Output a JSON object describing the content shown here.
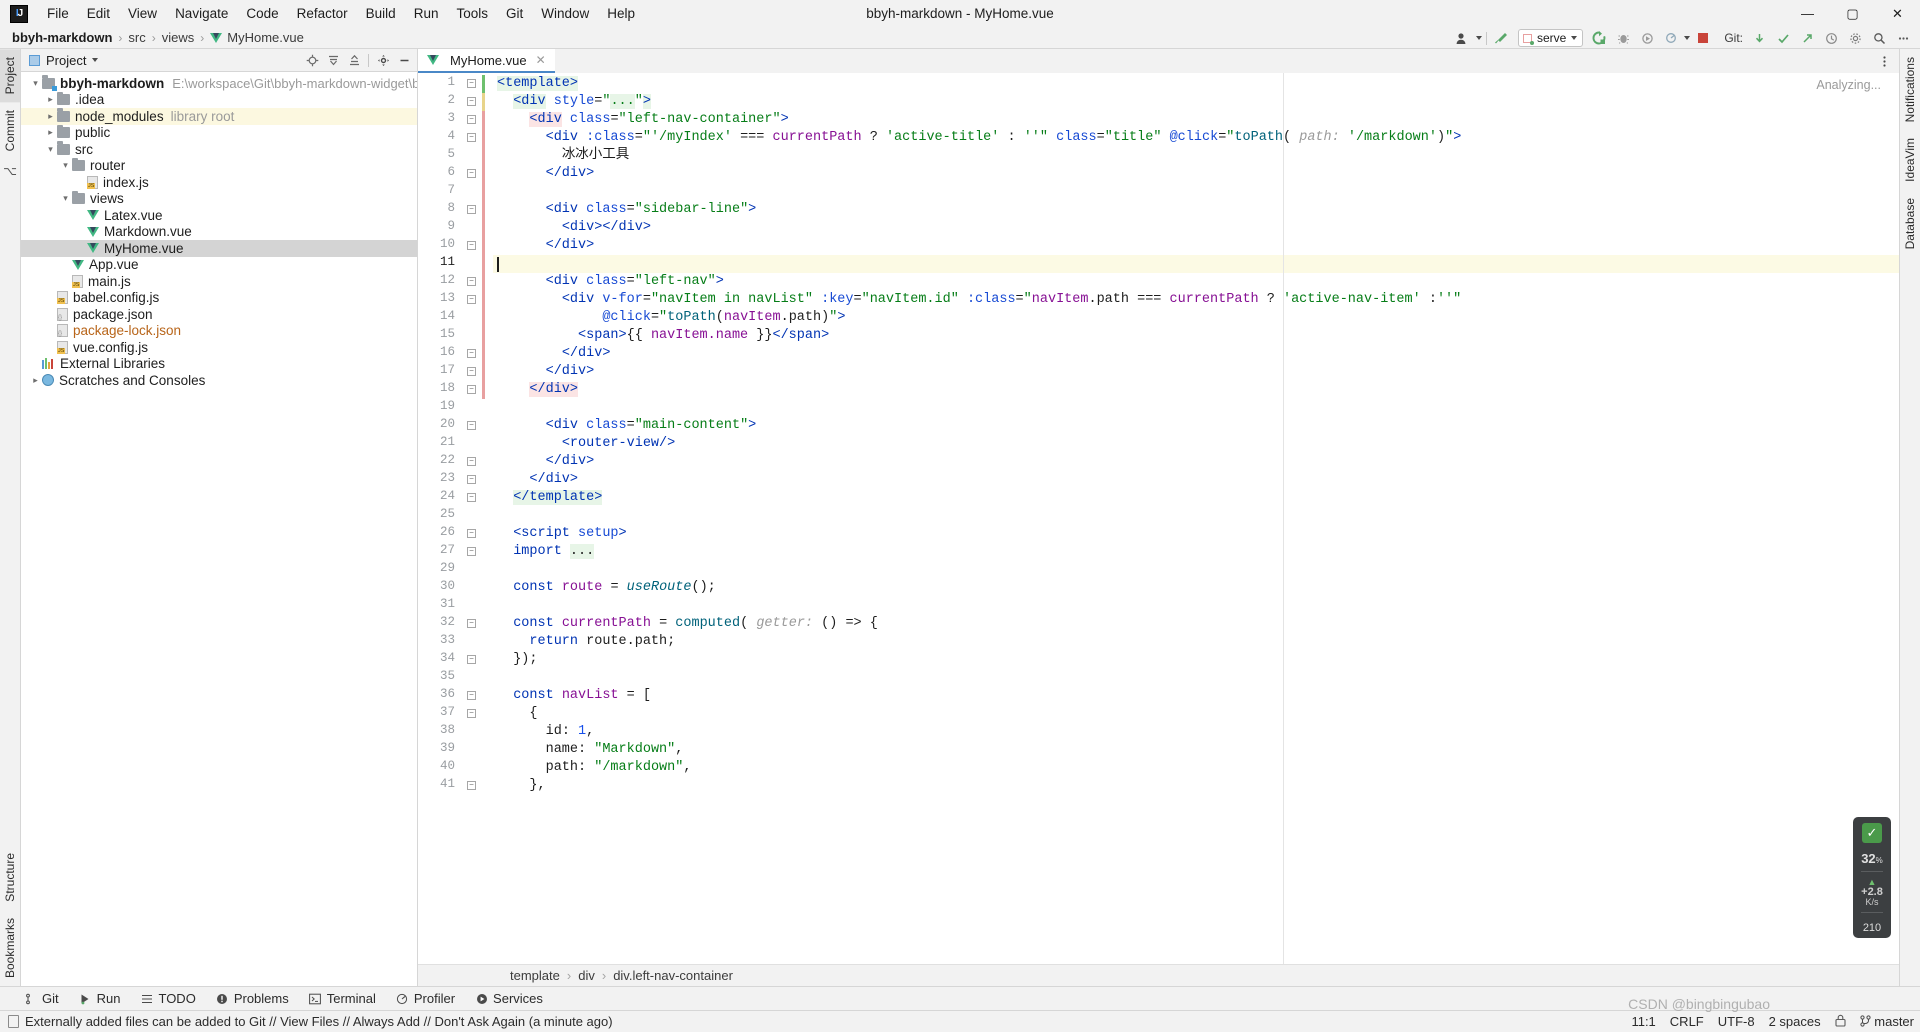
{
  "window": {
    "title": "bbyh-markdown - MyHome.vue",
    "logo_text": "IJ",
    "minimize": "—",
    "maximize": "▢",
    "close": "✕"
  },
  "menu": {
    "items": [
      "File",
      "Edit",
      "View",
      "Navigate",
      "Code",
      "Refactor",
      "Build",
      "Run",
      "Tools",
      "Git",
      "Window",
      "Help"
    ]
  },
  "breadcrumb": {
    "project": "bbyh-markdown",
    "parts": [
      "src",
      "views"
    ],
    "file": "MyHome.vue",
    "separator": "›"
  },
  "toolbar": {
    "profile_icon": "user-icon",
    "hammer_icon": "build-hammer-icon",
    "run_config": "serve",
    "rerun_icon": "rerun-icon",
    "debug_icon": "debug-icon",
    "stop_icon": "stop-icon",
    "git_label": "Git:",
    "git_update_icon": "git-update-icon",
    "git_commit_icon": "git-commit-icon",
    "git_push_icon": "git-push-icon",
    "history_icon": "history-icon",
    "settings_icon": "settings-gear-icon",
    "search_icon": "search-icon",
    "more_icon": "more-icon"
  },
  "left_rail": {
    "top": [
      "Project"
    ],
    "bottom": [
      "Structure",
      "Bookmarks"
    ],
    "commit": "Commit"
  },
  "right_rail": {
    "items": [
      "Notifications",
      "Database",
      "IdeaVim"
    ]
  },
  "project_pane": {
    "title": "Project",
    "icons": [
      "locate-icon",
      "expand-all-icon",
      "collapse-all-icon",
      "settings-icon",
      "hide-icon"
    ],
    "tree": [
      {
        "indent": 0,
        "arrow": "v",
        "icon": "folder-module",
        "label": "bbyh-markdown",
        "bold": true,
        "path": "E:\\workspace\\Git\\bbyh-markdown-widget\\bbyh-markdo",
        "state": "normal"
      },
      {
        "indent": 1,
        "arrow": ">",
        "icon": "folder",
        "label": ".idea",
        "state": "normal"
      },
      {
        "indent": 1,
        "arrow": ">",
        "icon": "folder",
        "label": "node_modules",
        "sub": "library root",
        "state": "highlight"
      },
      {
        "indent": 1,
        "arrow": ">",
        "icon": "folder",
        "label": "public",
        "state": "normal"
      },
      {
        "indent": 1,
        "arrow": "v",
        "icon": "folder",
        "label": "src",
        "state": "normal"
      },
      {
        "indent": 2,
        "arrow": "v",
        "icon": "folder",
        "label": "router",
        "state": "normal"
      },
      {
        "indent": 3,
        "arrow": "",
        "icon": "js",
        "label": "index.js",
        "state": "normal"
      },
      {
        "indent": 2,
        "arrow": "v",
        "icon": "folder",
        "label": "views",
        "state": "normal"
      },
      {
        "indent": 3,
        "arrow": "",
        "icon": "vue",
        "label": "Latex.vue",
        "state": "normal"
      },
      {
        "indent": 3,
        "arrow": "",
        "icon": "vue",
        "label": "Markdown.vue",
        "state": "normal"
      },
      {
        "indent": 3,
        "arrow": "",
        "icon": "vue",
        "label": "MyHome.vue",
        "state": "selected"
      },
      {
        "indent": 2,
        "arrow": "",
        "icon": "vue",
        "label": "App.vue",
        "state": "normal"
      },
      {
        "indent": 2,
        "arrow": "",
        "icon": "js",
        "label": "main.js",
        "state": "normal"
      },
      {
        "indent": 1,
        "arrow": "",
        "icon": "js",
        "label": "babel.config.js",
        "state": "normal"
      },
      {
        "indent": 1,
        "arrow": "",
        "icon": "json",
        "label": "package.json",
        "state": "normal"
      },
      {
        "indent": 1,
        "arrow": "",
        "icon": "json",
        "label": "package-lock.json",
        "state": "normal",
        "color": "orange"
      },
      {
        "indent": 1,
        "arrow": "",
        "icon": "js",
        "label": "vue.config.js",
        "state": "normal"
      },
      {
        "indent": 0,
        "arrow": "",
        "icon": "lib",
        "label": "External Libraries",
        "state": "normal"
      },
      {
        "indent": 0,
        "arrow": ">",
        "icon": "scratch",
        "label": "Scratches and Consoles",
        "state": "normal"
      }
    ]
  },
  "editor": {
    "tab": {
      "label": "MyHome.vue",
      "icon": "vue-icon",
      "close": "✕"
    },
    "status_right": "Analyzing...",
    "lines": [
      {
        "n": 1,
        "text": "<template>"
      },
      {
        "n": 2,
        "text": "  <div style=\"...\">"
      },
      {
        "n": 3,
        "text": "    <div class=\"left-nav-container\">"
      },
      {
        "n": 4,
        "text": "      <div :class=\"'/myIndex' === currentPath ? 'active-title' : ''\" class=\"title\" @click=\"toPath( path: '/markdown')\">"
      },
      {
        "n": 5,
        "text": "        冰冰小工具"
      },
      {
        "n": 6,
        "text": "      </div>"
      },
      {
        "n": 7,
        "text": ""
      },
      {
        "n": 8,
        "text": "      <div class=\"sidebar-line\">"
      },
      {
        "n": 9,
        "text": "        <div></div>"
      },
      {
        "n": 10,
        "text": "      </div>"
      },
      {
        "n": 11,
        "text": ""
      },
      {
        "n": 12,
        "text": "      <div class=\"left-nav\">"
      },
      {
        "n": 13,
        "text": "        <div v-for=\"navItem in navList\" :key=\"navItem.id\" :class=\"navItem.path === currentPath ? 'active-nav-item' :''\""
      },
      {
        "n": 14,
        "text": "             @click=\"toPath(navItem.path)\">"
      },
      {
        "n": 15,
        "text": "          <span>{{ navItem.name }}</span>"
      },
      {
        "n": 16,
        "text": "        </div>"
      },
      {
        "n": 17,
        "text": "      </div>"
      },
      {
        "n": 18,
        "text": "    </div>"
      },
      {
        "n": 19,
        "text": ""
      },
      {
        "n": 20,
        "text": "      <div class=\"main-content\">"
      },
      {
        "n": 21,
        "text": "        <router-view/>"
      },
      {
        "n": 22,
        "text": "      </div>"
      },
      {
        "n": 23,
        "text": "    </div>"
      },
      {
        "n": 24,
        "text": "  </template>"
      },
      {
        "n": 25,
        "text": ""
      },
      {
        "n": 26,
        "text": "  <script setup>"
      },
      {
        "n": 27,
        "text": "  import ..."
      },
      {
        "n": 29,
        "text": ""
      },
      {
        "n": 30,
        "text": "  const route = useRoute();"
      },
      {
        "n": 31,
        "text": ""
      },
      {
        "n": 32,
        "text": "  const currentPath = computed( getter: () => {"
      },
      {
        "n": 33,
        "text": "    return route.path;"
      },
      {
        "n": 34,
        "text": "  });"
      },
      {
        "n": 35,
        "text": ""
      },
      {
        "n": 36,
        "text": "  const navList = ["
      },
      {
        "n": 37,
        "text": "    {"
      },
      {
        "n": 38,
        "text": "      id: 1,"
      },
      {
        "n": 39,
        "text": "      name: \"Markdown\","
      },
      {
        "n": 40,
        "text": "      path: \"/markdown\","
      },
      {
        "n": 41,
        "text": "    },"
      }
    ],
    "breadcrumbs": [
      "template",
      "div",
      "div.left-nav-container"
    ],
    "breadcrumb_sep": "›"
  },
  "inspection_widget": {
    "status_icon": "check-icon",
    "percent": "32",
    "percent_unit": "%",
    "delta": "+2.8",
    "delta_unit": "K/s",
    "memory": "210"
  },
  "bottom_tools": [
    {
      "label": "Git",
      "icon": "git-branch-icon"
    },
    {
      "label": "Run",
      "icon": "run-icon"
    },
    {
      "label": "TODO",
      "icon": "todo-icon"
    },
    {
      "label": "Problems",
      "icon": "problems-icon"
    },
    {
      "label": "Terminal",
      "icon": "terminal-icon"
    },
    {
      "label": "Profiler",
      "icon": "profiler-icon"
    },
    {
      "label": "Services",
      "icon": "services-icon"
    }
  ],
  "statusbar": {
    "message": "Externally added files can be added to Git // View Files // Always Add // Don't Ask Again (a minute ago)",
    "caret": "11:1",
    "line_sep": "CRLF",
    "encoding": "UTF-8",
    "indent": "2 spaces",
    "branch": "master",
    "lock_icon": "lock-icon",
    "branch_icon": "git-branch-icon"
  },
  "watermark": "CSDN @bingbingubao",
  "colors": {
    "accent": "#4a88c7",
    "vue_green": "#41b883",
    "string": "#067d17",
    "tag": "#0033b3",
    "variable": "#871094",
    "selection": "#d4d4d4",
    "highlight_line": "#fcfae4"
  }
}
